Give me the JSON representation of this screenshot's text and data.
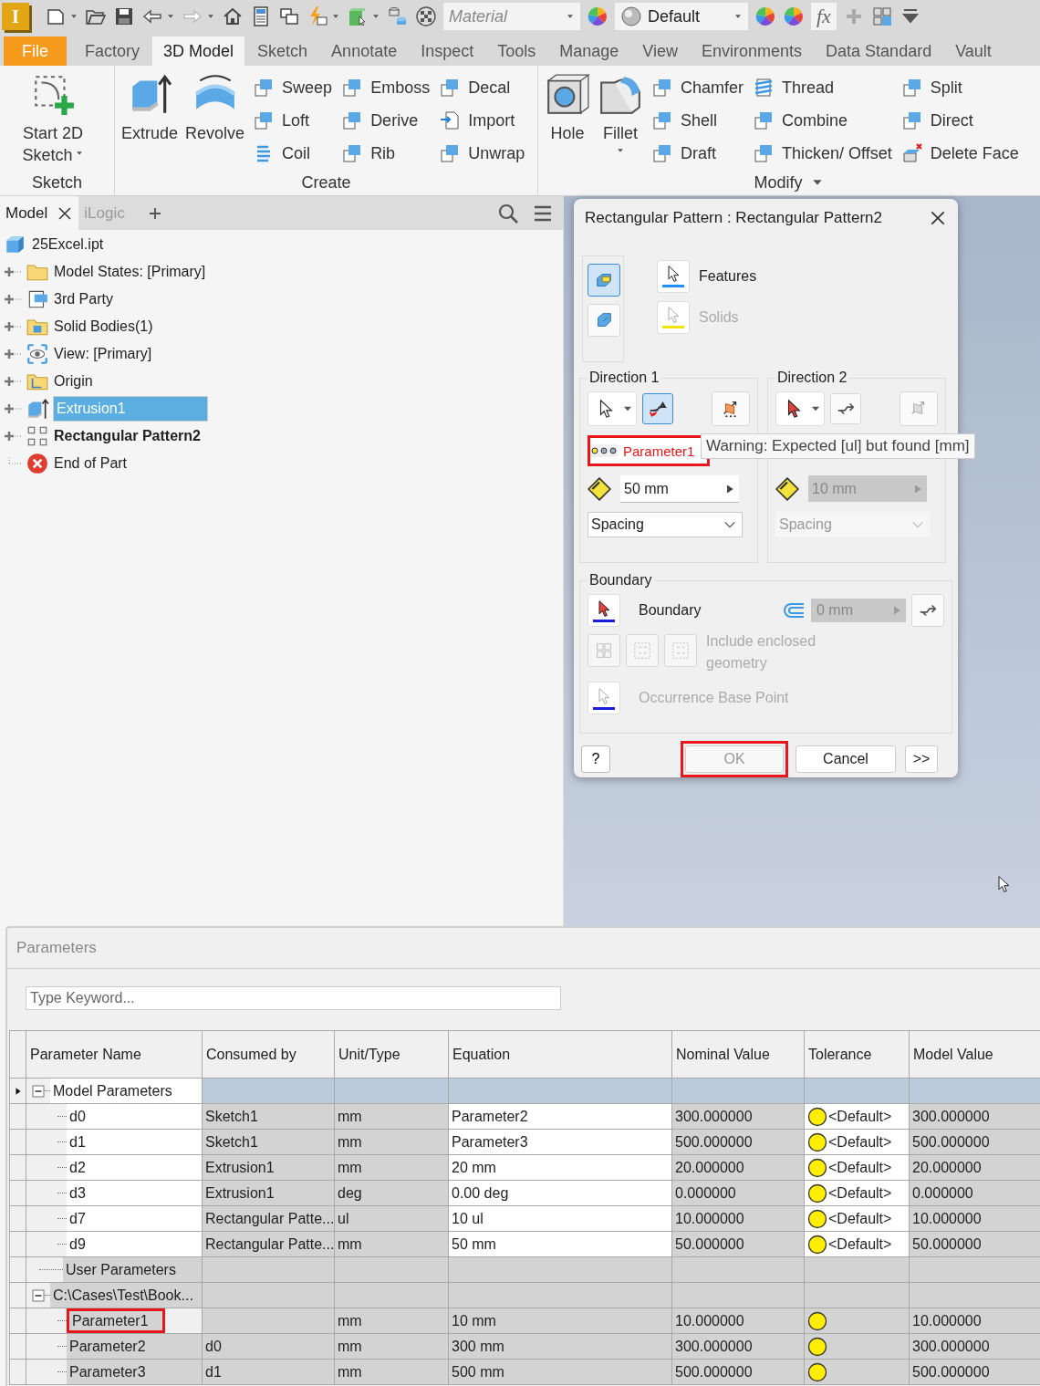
{
  "quick_access": {
    "app_logo": "I",
    "material": {
      "placeholder": "Material"
    },
    "appearance": {
      "value": "Default"
    },
    "function_label": "fx"
  },
  "ribbon_tabs": [
    {
      "label": "File",
      "kind": "file",
      "selected": false
    },
    {
      "label": "Factory",
      "kind": "tab",
      "selected": false
    },
    {
      "label": "3D Model",
      "kind": "tab",
      "selected": true
    },
    {
      "label": "Sketch",
      "kind": "tab",
      "selected": false
    },
    {
      "label": "Annotate",
      "kind": "tab",
      "selected": false
    },
    {
      "label": "Inspect",
      "kind": "tab",
      "selected": false
    },
    {
      "label": "Tools",
      "kind": "tab",
      "selected": false
    },
    {
      "label": "Manage",
      "kind": "tab",
      "selected": false
    },
    {
      "label": "View",
      "kind": "tab",
      "selected": false
    },
    {
      "label": "Environments",
      "kind": "tab",
      "selected": false
    },
    {
      "label": "Data Standard",
      "kind": "tab",
      "selected": false
    },
    {
      "label": "Vault",
      "kind": "tab",
      "selected": false
    }
  ],
  "ribbon_panels": [
    {
      "title": "Sketch",
      "large": [
        {
          "label": "Start 2D Sketch",
          "dropdown": true
        }
      ]
    },
    {
      "title": "Create",
      "large": [
        {
          "label": "Extrude"
        },
        {
          "label": "Revolve"
        }
      ],
      "small": [
        [
          "Sweep",
          "Loft",
          "Coil"
        ],
        [
          "Emboss",
          "Derive",
          "Rib"
        ],
        [
          "Decal",
          "Import",
          "Unwrap"
        ]
      ]
    },
    {
      "title": "Modify",
      "menu": true,
      "large": [
        {
          "label": "Hole"
        },
        {
          "label": "Fillet",
          "dropdown": true
        }
      ],
      "small": [
        [
          "Chamfer",
          "Shell",
          "Draft"
        ],
        [
          "Thread",
          "Combine",
          "Thicken/ Offset"
        ],
        [
          "Split",
          "Direct",
          "Delete Face"
        ]
      ]
    }
  ],
  "browser": {
    "tabs": [
      {
        "label": "Model",
        "selected": true,
        "closable": true
      },
      {
        "label": "iLogic",
        "selected": false,
        "closable": false
      }
    ],
    "tree": {
      "label": "25Excel.ipt",
      "children": [
        {
          "label": "Model States: [Primary]",
          "kind": "folder",
          "expandable": true,
          "selected": false,
          "active": false
        },
        {
          "label": "3rd Party",
          "kind": "third-party",
          "expandable": true,
          "selected": false,
          "active": false
        },
        {
          "label": "Solid Bodies(1)",
          "kind": "bodies",
          "expandable": true,
          "selected": false,
          "active": false
        },
        {
          "label": "View: [Primary]",
          "kind": "view",
          "expandable": true,
          "selected": false,
          "active": false
        },
        {
          "label": "Origin",
          "kind": "origin",
          "expandable": true,
          "selected": false,
          "active": false
        },
        {
          "label": "Extrusion1",
          "kind": "extrusion",
          "expandable": true,
          "selected": true,
          "active": false
        },
        {
          "label": "Rectangular Pattern2",
          "kind": "pattern",
          "expandable": true,
          "selected": false,
          "active": true
        },
        {
          "label": "End of Part",
          "kind": "end",
          "expandable": false,
          "selected": false,
          "active": false
        }
      ]
    }
  },
  "dialog": {
    "title": "Rectangular Pattern : Rectangular Pattern2",
    "modes": [
      {
        "selected": true
      },
      {
        "selected": false
      }
    ],
    "selectors": [
      {
        "label": "Features",
        "color": "#1e90ff",
        "disabled": false
      },
      {
        "label": "Solids",
        "color": "#f2e600",
        "disabled": true
      }
    ],
    "directions": [
      {
        "title": "Direction 1",
        "disabled": false,
        "flip_selected": true,
        "count": {
          "value": "Parameter1",
          "error": true,
          "highlighted": true
        },
        "spacing": "50 mm",
        "method": "Spacing"
      },
      {
        "title": "Direction 2",
        "disabled": true,
        "flip_selected": false,
        "spacing": "10 mm",
        "method": "Spacing"
      }
    ],
    "tooltip": "Warning: Expected [ul] but found [mm]",
    "boundary": {
      "title": "Boundary",
      "selector": "Boundary",
      "offset": "0 mm",
      "include": {
        "label": "Include enclosed geometry",
        "disabled": true
      },
      "base_point": {
        "label": "Occurrence Base Point",
        "disabled": true
      }
    },
    "help": "?",
    "buttons": [
      {
        "label": "OK",
        "disabled": true,
        "highlighted": true
      },
      {
        "label": "Cancel",
        "disabled": false,
        "highlighted": false
      },
      {
        "label": ">>",
        "disabled": false,
        "highlighted": false
      }
    ]
  },
  "parameters": {
    "title": "Parameters",
    "search": {
      "placeholder": "Type Keyword..."
    },
    "columns": [
      "Parameter Name",
      "Consumed by",
      "Unit/Type",
      "Equation",
      "Nominal Value",
      "Tolerance",
      "Model Value"
    ],
    "rows": [
      {
        "name": "Model Parameters",
        "current": true,
        "linked": false,
        "expanded": true,
        "children": [
          {
            "name": "d0",
            "consumed_by": "Sketch1",
            "unit": "mm",
            "equation": "Parameter2",
            "nominal": "300.000000",
            "tolerance": "<Default>",
            "model_value": "300.000000",
            "highlighted": false
          },
          {
            "name": "d1",
            "consumed_by": "Sketch1",
            "unit": "mm",
            "equation": "Parameter3",
            "nominal": "500.000000",
            "tolerance": "<Default>",
            "model_value": "500.000000",
            "highlighted": false
          },
          {
            "name": "d2",
            "consumed_by": "Extrusion1",
            "unit": "mm",
            "equation": "20 mm",
            "nominal": "20.000000",
            "tolerance": "<Default>",
            "model_value": "20.000000",
            "highlighted": false
          },
          {
            "name": "d3",
            "consumed_by": "Extrusion1",
            "unit": "deg",
            "equation": "0.00 deg",
            "nominal": "0.000000",
            "tolerance": "<Default>",
            "model_value": "0.000000",
            "highlighted": false
          },
          {
            "name": "d7",
            "consumed_by": "Rectangular Patte...",
            "unit": "ul",
            "equation": "10 ul",
            "nominal": "10.000000",
            "tolerance": "<Default>",
            "model_value": "10.000000",
            "highlighted": false
          },
          {
            "name": "d9",
            "consumed_by": "Rectangular Patte...",
            "unit": "mm",
            "equation": "50 mm",
            "nominal": "50.000000",
            "tolerance": "<Default>",
            "model_value": "50.000000",
            "highlighted": false
          }
        ]
      },
      {
        "name": "User Parameters",
        "current": false
      },
      {
        "name": "C:\\Cases\\Test\\Book...",
        "current": false,
        "linked": true,
        "expanded": true,
        "children": [
          {
            "name": "Parameter1",
            "unit": "mm",
            "equation": "10 mm",
            "nominal": "10.000000",
            "model_value": "10.000000",
            "highlighted": true
          },
          {
            "name": "Parameter2",
            "consumed_by": "d0",
            "unit": "mm",
            "equation": "300 mm",
            "nominal": "300.000000",
            "model_value": "300.000000",
            "highlighted": false
          },
          {
            "name": "Parameter3",
            "consumed_by": "d1",
            "unit": "mm",
            "equation": "500 mm",
            "nominal": "500.000000",
            "model_value": "500.000000",
            "highlighted": false
          }
        ]
      }
    ]
  }
}
